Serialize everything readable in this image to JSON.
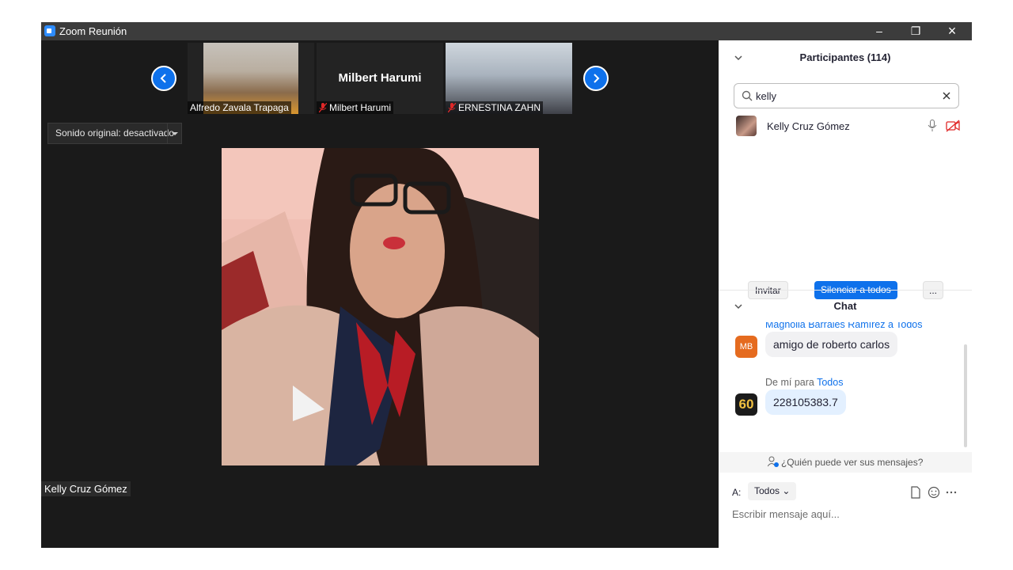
{
  "window": {
    "title": "Zoom Reunión"
  },
  "thumbnails": [
    {
      "name": "Alfredo Zavala Trapaga"
    },
    {
      "display": "Milbert Harumi",
      "name": "Milbert Harumi"
    },
    {
      "name": "ERNESTINA ZAHN"
    }
  ],
  "stage": {
    "sound_button": "Sonido original: desactivado",
    "speaker_name": "Kelly Cruz Gómez"
  },
  "participants": {
    "header": "Participantes (114)",
    "search_value": "kelly",
    "items": [
      {
        "name": "Kelly Cruz Gómez"
      }
    ],
    "invite_label": "Invitar",
    "mute_all_label": "Silenciar a todos",
    "more_label": "..."
  },
  "chat": {
    "header": "Chat",
    "messages": [
      {
        "sender": "Magnolia Barrales Ramírez",
        "to_prefix": "a",
        "to": "Todos",
        "avatar": "MB",
        "text": "amigo de roberto carlos"
      },
      {
        "sender": "De mí",
        "to_prefix": "para",
        "to": "Todos",
        "avatar": "60",
        "text": "228105383.7"
      }
    ],
    "visibility_link": "¿Quién puede ver sus mensajes?",
    "to_label": "A:",
    "to_value": "Todos",
    "placeholder": "Escribir mensaje aquí..."
  },
  "colors": {
    "accent": "#0e71eb",
    "stage_bg": "#1a1a1a",
    "titlebar": "#3c3c3c"
  }
}
